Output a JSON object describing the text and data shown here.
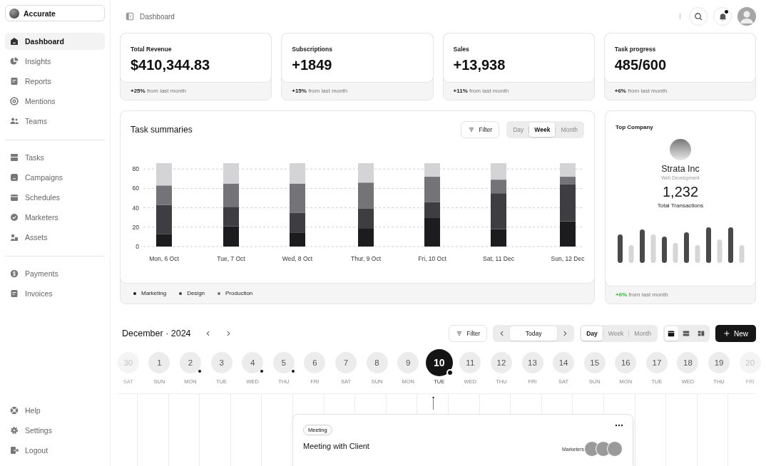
{
  "sidebar": {
    "brand": "Accurate",
    "groups": [
      {
        "items": [
          {
            "label": "Dashboard",
            "selected": true
          },
          {
            "label": "Insights",
            "selected": false
          },
          {
            "label": "Reports",
            "selected": false
          },
          {
            "label": "Mentions",
            "selected": false
          },
          {
            "label": "Teams",
            "selected": false
          }
        ]
      },
      {
        "items": [
          {
            "label": "Tasks",
            "selected": false
          },
          {
            "label": "Campaigns",
            "selected": false
          },
          {
            "label": "Schedules",
            "selected": false
          },
          {
            "label": "Marketers",
            "selected": false
          },
          {
            "label": "Assets",
            "selected": false
          }
        ]
      },
      {
        "items": [
          {
            "label": "Payments",
            "selected": false
          },
          {
            "label": "Invoices",
            "selected": false
          }
        ]
      }
    ],
    "footer": [
      {
        "label": "Help",
        "selected": false
      },
      {
        "label": "Settings",
        "selected": false
      },
      {
        "label": "Logout",
        "selected": false
      }
    ]
  },
  "header": {
    "title": "Dashboard",
    "unread": true
  },
  "stats": [
    {
      "label": "Total Revenue",
      "value": "$410,344.83",
      "change": "+25%",
      "note": "from last month"
    },
    {
      "label": "Subscriptions",
      "value": "+1849",
      "change": "+15%",
      "note": "from last month"
    },
    {
      "label": "Sales",
      "value": "+13,938",
      "change": "+11%",
      "note": "from last month"
    },
    {
      "label": "Task progress",
      "value": "485/600",
      "change": "+6%",
      "note": "from last month"
    }
  ],
  "task_summaries": {
    "title": "Task summaries",
    "filter": "Filter",
    "periods": [
      {
        "label": "Day",
        "selected": false
      },
      {
        "label": "Week",
        "selected": true
      },
      {
        "label": "Month",
        "selected": false
      }
    ],
    "chart_data": {
      "type": "bar",
      "stacked": true,
      "categories": [
        "Mon, 6 Oct",
        "Tue, 7 Oct",
        "Wed, 8 Oct",
        "Thur, 9 Oct",
        "Fri, 10 Oct",
        "Sat, 11 Dec",
        "Sun, 12 Dec"
      ],
      "series": [
        {
          "name": "Marketing",
          "color": "#1c1c1e",
          "values": [
            13,
            21,
            14,
            19,
            30,
            18,
            26
          ]
        },
        {
          "name": "Design",
          "color": "#3e3e42",
          "values": [
            30,
            20,
            21,
            20,
            16,
            37,
            38
          ]
        },
        {
          "name": "Production",
          "color": "#737378",
          "values": [
            20,
            24,
            30,
            27,
            26,
            14,
            8
          ]
        }
      ],
      "ylim": [
        0,
        86
      ],
      "yticks": [
        0,
        20,
        40,
        60,
        80
      ],
      "grid": true
    }
  },
  "top_company": {
    "title": "Top Company",
    "name": "Strata Inc",
    "industry": "Web Development",
    "value": "1,232",
    "value_label": "Total Transactions",
    "change": "+6%",
    "note": "from last month"
  },
  "calendar": {
    "title": "December · 2024",
    "filter": "Filter",
    "today": "Today",
    "periods": [
      {
        "label": "Day",
        "selected": true
      },
      {
        "label": "Week",
        "selected": false
      },
      {
        "label": "Month",
        "selected": false
      }
    ],
    "views": [
      {
        "selected": true
      },
      {
        "selected": false
      },
      {
        "selected": false
      }
    ],
    "new": "New",
    "days": [
      {
        "day": "30",
        "weekday": "SAT",
        "selected": false,
        "event": false,
        "edge": true
      },
      {
        "day": "1",
        "weekday": "SUN",
        "selected": false,
        "event": false,
        "edge": false
      },
      {
        "day": "2",
        "weekday": "MON",
        "selected": false,
        "event": true,
        "edge": false
      },
      {
        "day": "3",
        "weekday": "TUE",
        "selected": false,
        "event": false,
        "edge": false
      },
      {
        "day": "4",
        "weekday": "WED",
        "selected": false,
        "event": true,
        "edge": false
      },
      {
        "day": "5",
        "weekday": "THU",
        "selected": false,
        "event": true,
        "edge": false
      },
      {
        "day": "6",
        "weekday": "FRI",
        "selected": false,
        "event": false,
        "edge": false
      },
      {
        "day": "7",
        "weekday": "SAT",
        "selected": false,
        "event": false,
        "edge": false
      },
      {
        "day": "8",
        "weekday": "SUN",
        "selected": false,
        "event": false,
        "edge": false
      },
      {
        "day": "9",
        "weekday": "MON",
        "selected": false,
        "event": false,
        "edge": false
      },
      {
        "day": "10",
        "weekday": "TUE",
        "selected": true,
        "event": true,
        "edge": false
      },
      {
        "day": "11",
        "weekday": "WED",
        "selected": false,
        "event": false,
        "edge": false
      },
      {
        "day": "12",
        "weekday": "THU",
        "selected": false,
        "event": false,
        "edge": false
      },
      {
        "day": "13",
        "weekday": "FRI",
        "selected": false,
        "event": false,
        "edge": false
      },
      {
        "day": "14",
        "weekday": "SAT",
        "selected": false,
        "event": false,
        "edge": false
      },
      {
        "day": "15",
        "weekday": "SUN",
        "selected": false,
        "event": false,
        "edge": false
      },
      {
        "day": "16",
        "weekday": "MON",
        "selected": false,
        "event": false,
        "edge": false
      },
      {
        "day": "17",
        "weekday": "TUE",
        "selected": false,
        "event": false,
        "edge": false
      },
      {
        "day": "18",
        "weekday": "WED",
        "selected": false,
        "event": false,
        "edge": false
      },
      {
        "day": "19",
        "weekday": "THU",
        "selected": false,
        "event": false,
        "edge": false
      },
      {
        "day": "20",
        "weekday": "FRI",
        "selected": false,
        "event": false,
        "edge": true
      }
    ],
    "event": {
      "tag": "Meeting",
      "title": "Meeting with Client",
      "marketers_label": "Marketers:"
    }
  }
}
